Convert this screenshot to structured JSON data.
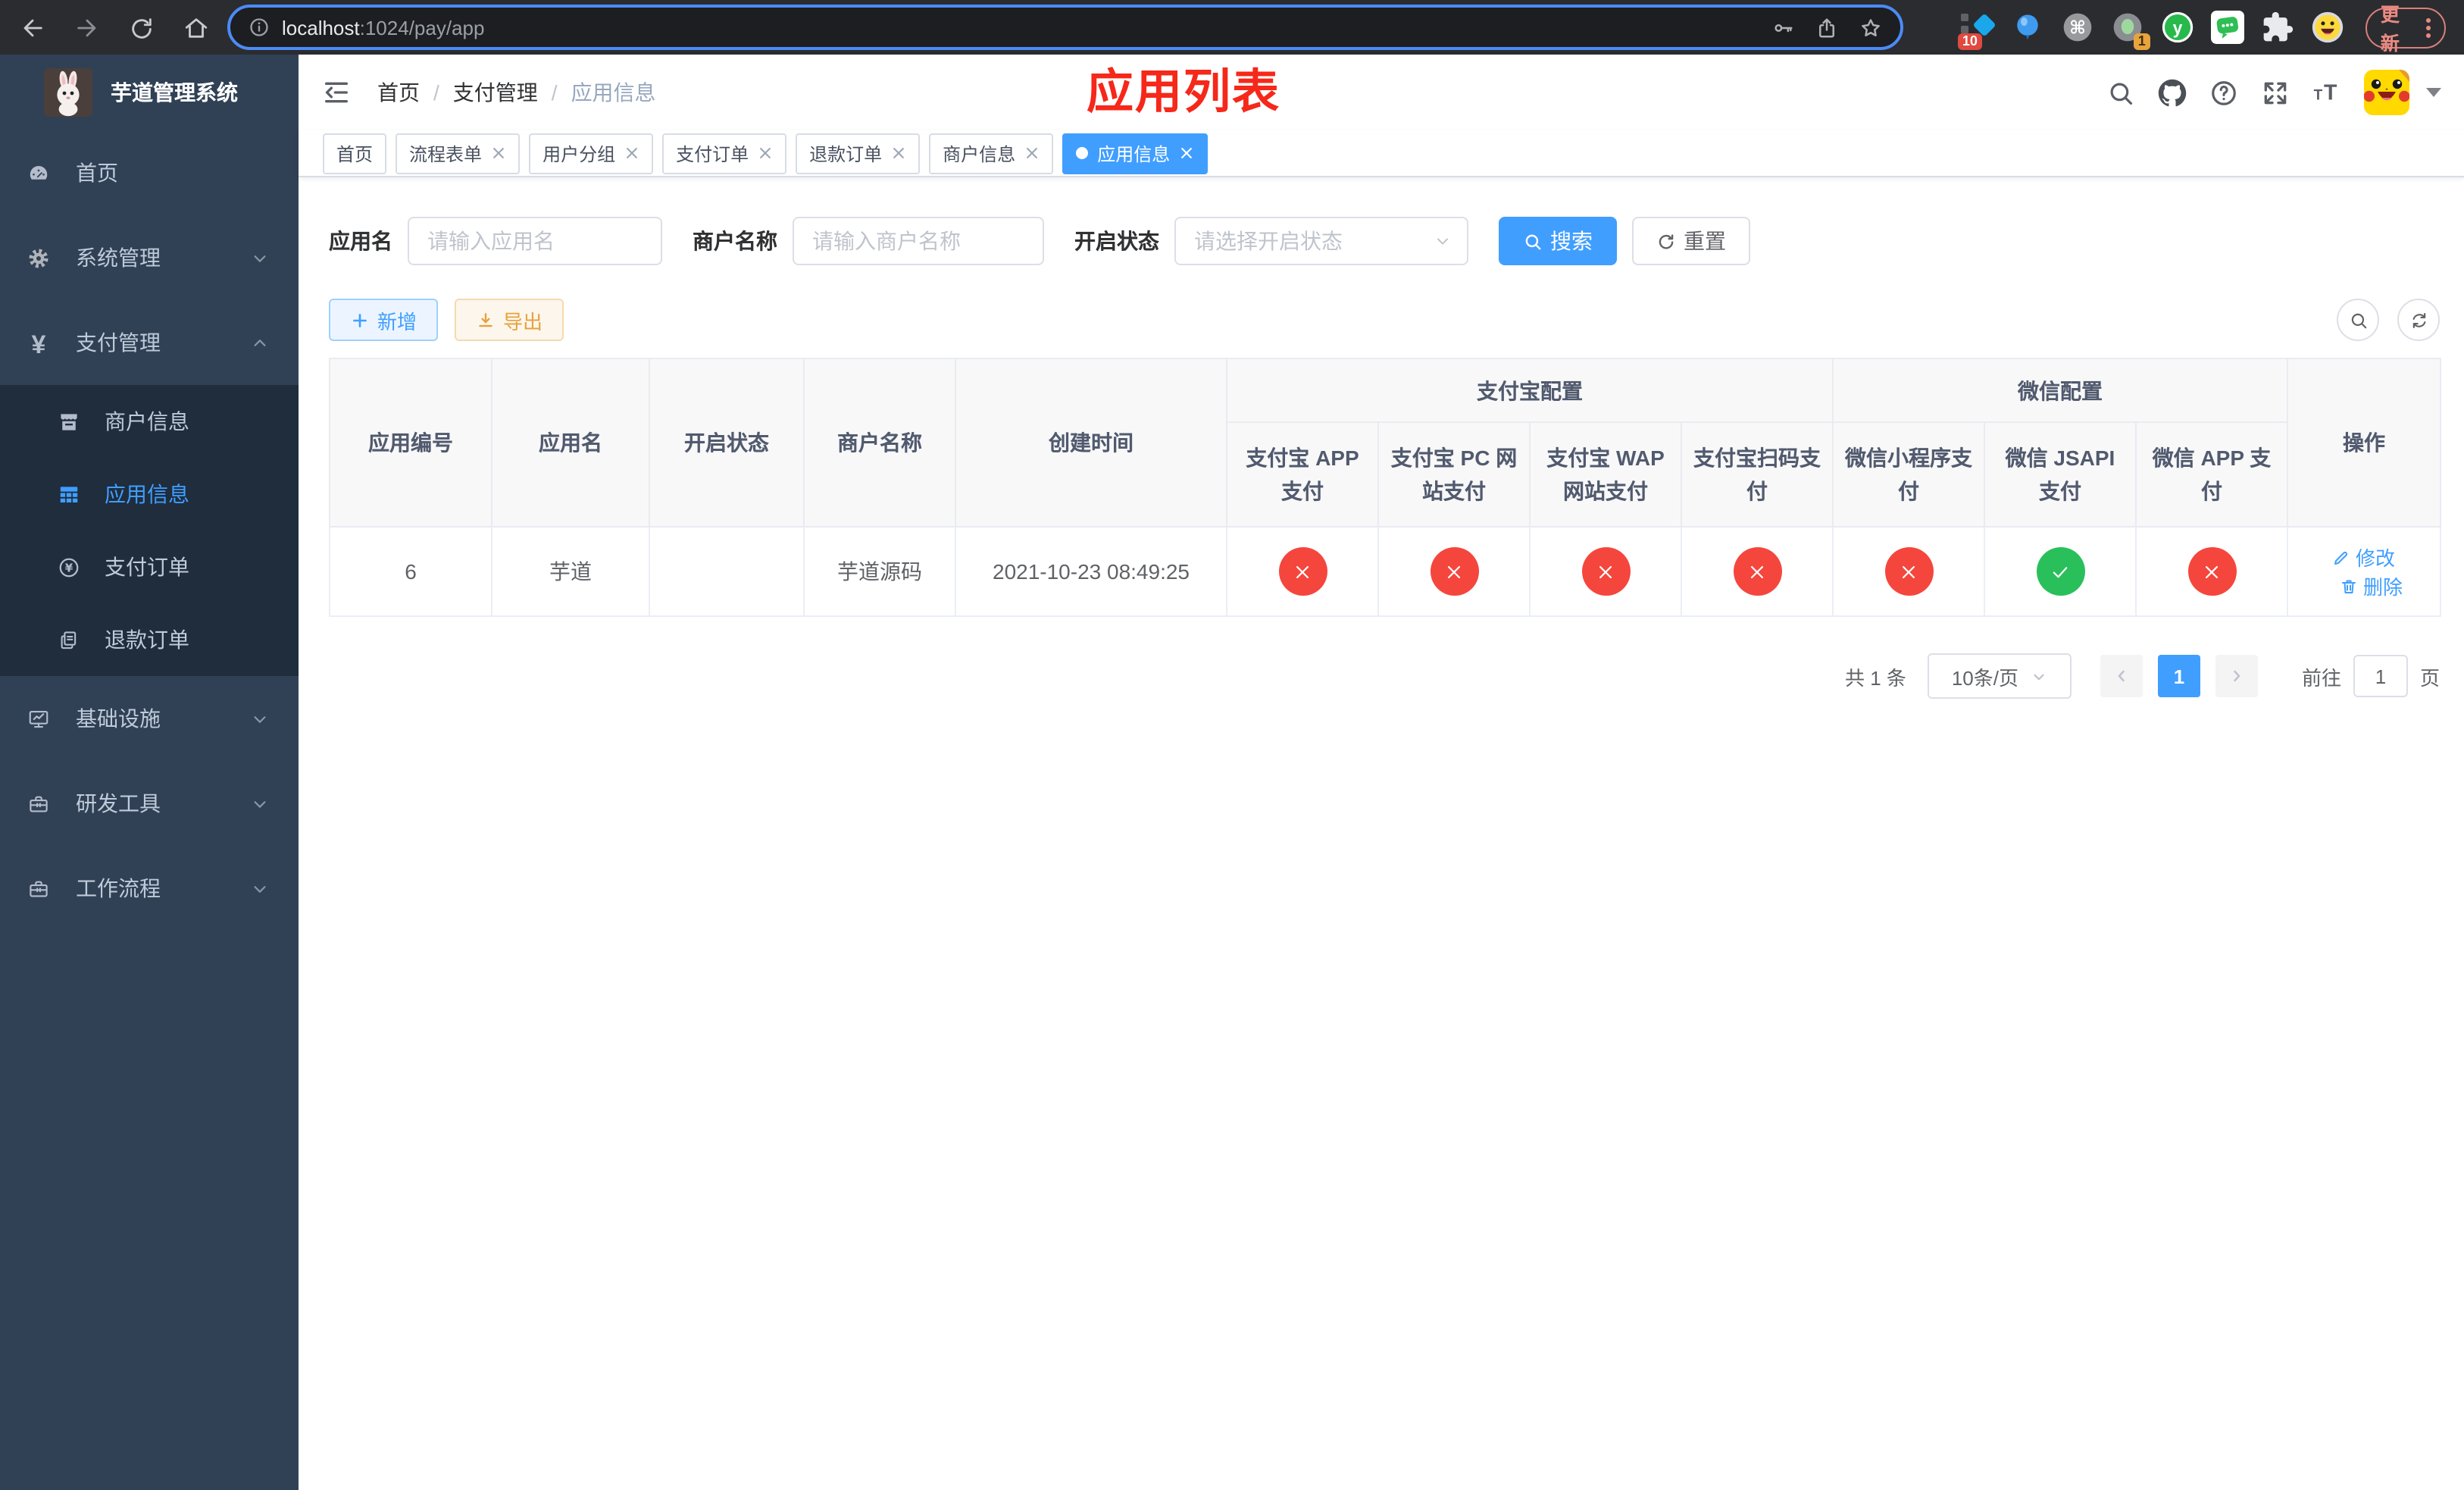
{
  "colors": {
    "accent": "#409eff",
    "success_green": "#29c05c",
    "danger_red": "#f5463d",
    "warning_orange": "#e6a23c",
    "sidebar_bg": "#304156",
    "sidebar_submenu_bg": "#1f2d3d",
    "overlay_title_red": "#f5281a"
  },
  "icons": {
    "search": "magnifier",
    "reset": "circular-arrow",
    "add": "plus",
    "export": "download-arrow",
    "edit": "pencil",
    "delete": "trash",
    "enabled_no": "red-circle-x",
    "enabled_yes": "green-circle-check"
  },
  "browser": {
    "url_host": "localhost",
    "url_path": ":1024/pay/app",
    "update_label": "更新",
    "badge_ten": "10",
    "badge_one": "1"
  },
  "sidebar": {
    "logo_title": "芋道管理系统",
    "items": [
      {
        "label": "首页",
        "icon": "dashboard-icon"
      },
      {
        "label": "系统管理",
        "icon": "gear-icon"
      },
      {
        "label": "支付管理",
        "icon": "yen-icon"
      },
      {
        "label": "基础设施",
        "icon": "monitor-icon"
      },
      {
        "label": "研发工具",
        "icon": "toolbox-icon"
      },
      {
        "label": "工作流程",
        "icon": "toolbox-icon"
      }
    ],
    "submenu": [
      {
        "label": "商户信息",
        "icon": "shop-icon"
      },
      {
        "label": "应用信息",
        "icon": "grid-icon",
        "active": true
      },
      {
        "label": "支付订单",
        "icon": "yen-circle-icon"
      },
      {
        "label": "退款订单",
        "icon": "documents-icon"
      }
    ]
  },
  "navbar": {
    "breadcrumb": {
      "home": "首页",
      "separator": "/",
      "section": "支付管理",
      "current": "应用信息"
    },
    "overlay_title": "应用列表"
  },
  "tabs": [
    {
      "label": "首页"
    },
    {
      "label": "流程表单"
    },
    {
      "label": "用户分组"
    },
    {
      "label": "支付订单"
    },
    {
      "label": "退款订单"
    },
    {
      "label": "商户信息"
    },
    {
      "label": "应用信息",
      "active": true
    }
  ],
  "filters": {
    "app_name_label": "应用名",
    "app_name_placeholder": "请输入应用名",
    "merchant_label": "商户名称",
    "merchant_placeholder": "请输入商户名称",
    "status_label": "开启状态",
    "status_placeholder": "请选择开启状态",
    "search_label": "搜索",
    "reset_label": "重置"
  },
  "toolbar": {
    "add_label": "新增",
    "export_label": "导出"
  },
  "table": {
    "columns": [
      "应用编号",
      "应用名",
      "开启状态",
      "商户名称",
      "创建时间"
    ],
    "group_alipay": "支付宝配置",
    "group_wechat": "微信配置",
    "sub_columns": [
      "支付宝 APP 支付",
      "支付宝 PC 网站支付",
      "支付宝 WAP 网站支付",
      "支付宝扫码支付",
      "微信小程序支付",
      "微信 JSAPI 支付",
      "微信 APP 支付"
    ],
    "actions_col": "操作",
    "row": {
      "id": "6",
      "name": "芋道",
      "enabled": true,
      "merchant": "芋道源码",
      "created": "2021-10-23 08:49:25",
      "configs": [
        "no",
        "no",
        "no",
        "no",
        "no",
        "yes",
        "no"
      ],
      "edit_label": "修改",
      "delete_label": "删除"
    }
  },
  "pagination": {
    "total_text": "共 1 条",
    "page_size": "10条/页",
    "current_page": "1",
    "goto_label": "前往",
    "goto_value": "1",
    "page_suffix": "页"
  }
}
